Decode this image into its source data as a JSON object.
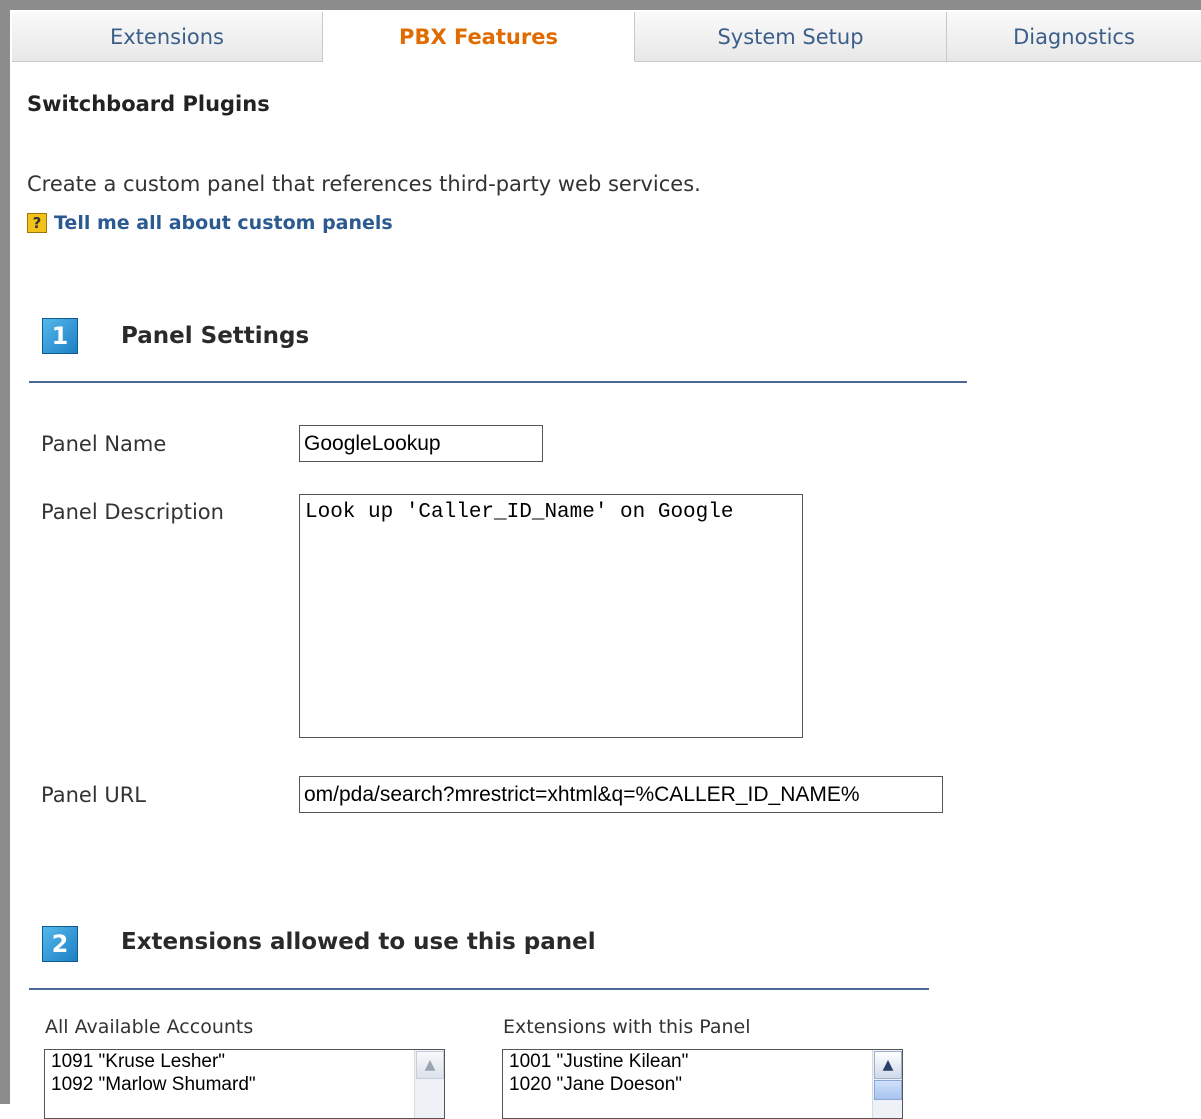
{
  "tabs": [
    {
      "label": "Extensions",
      "active": false
    },
    {
      "label": "PBX Features",
      "active": true
    },
    {
      "label": "System Setup",
      "active": false
    },
    {
      "label": "Diagnostics",
      "active": false
    }
  ],
  "page": {
    "title": "Switchboard Plugins",
    "intro": "Create a custom panel that references third-party web services.",
    "help_icon": "question-icon",
    "help_icon_glyph": "?",
    "help_link": "Tell me all about custom panels"
  },
  "section1": {
    "number": "1",
    "title": "Panel Settings",
    "panel_name_label": "Panel Name",
    "panel_name_value": "GoogleLookup",
    "panel_description_label": "Panel Description",
    "panel_description_value": "Look up 'Caller_ID_Name' on Google",
    "panel_url_label": "Panel URL",
    "panel_url_value": "om/pda/search?mrestrict=xhtml&q=%CALLER_ID_NAME%"
  },
  "section2": {
    "number": "2",
    "title": "Extensions allowed to use this panel",
    "available_label": "All Available Accounts",
    "available_items": [
      "1091 \"Kruse Lesher\"",
      "1092 \"Marlow Shumard\""
    ],
    "assigned_label": "Extensions with this Panel",
    "assigned_items": [
      "1001 \"Justine Kilean\"",
      "1020 \"Jane Doeson\""
    ]
  },
  "colors": {
    "active_tab": "#e06b00",
    "link": "#2b5a91",
    "rule": "#4a6a9a"
  }
}
